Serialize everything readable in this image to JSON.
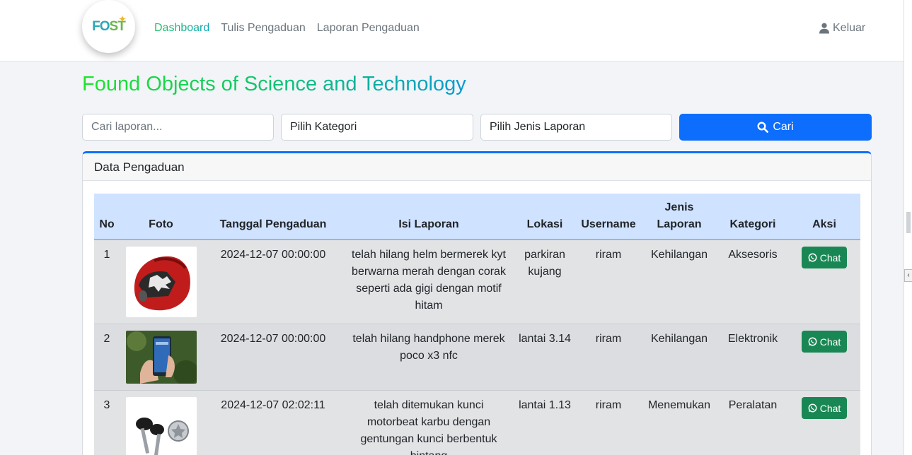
{
  "brand": {
    "logo_text_1": "FO",
    "logo_text_2": "ST",
    "logo_mark": "✦"
  },
  "nav": {
    "items": [
      {
        "label": "Dashboard",
        "active": true
      },
      {
        "label": "Tulis Pengaduan",
        "active": false
      },
      {
        "label": "Laporan Pengaduan",
        "active": false
      }
    ],
    "logout_label": "Keluar",
    "logout_icon": "user-icon"
  },
  "page": {
    "title": "Found Objects of Science and Technology"
  },
  "filters": {
    "search_placeholder": "Cari laporan...",
    "category_select": "Pilih Kategori",
    "type_select": "Pilih Jenis Laporan",
    "search_button": "Cari",
    "search_icon": "search-icon"
  },
  "card": {
    "header": "Data Pengaduan",
    "columns": [
      "No",
      "Foto",
      "Tanggal Pengaduan",
      "Isi Laporan",
      "Lokasi",
      "Username",
      "Jenis Laporan",
      "Kategori",
      "Aksi"
    ],
    "rows": [
      {
        "no": "1",
        "photo": "helmet-photo",
        "date": "2024-12-07 00:00:00",
        "content": "telah hilang helm bermerek kyt berwarna merah dengan corak seperti ada gigi dengan motif hitam",
        "location": "parkiran kujang",
        "username": "riram",
        "type": "Kehilangan",
        "category": "Aksesoris",
        "action": "Chat"
      },
      {
        "no": "2",
        "photo": "phone-photo",
        "date": "2024-12-07 00:00:00",
        "content": "telah hilang handphone merek poco x3 nfc",
        "location": "lantai 3.14",
        "username": "riram",
        "type": "Kehilangan",
        "category": "Elektronik",
        "action": "Chat"
      },
      {
        "no": "3",
        "photo": "keys-photo",
        "date": "2024-12-07 02:02:11",
        "content": "telah ditemukan kunci motorbeat karbu dengan gentungan kunci berbentuk bintang",
        "location": "lantai 1.13",
        "username": "riram",
        "type": "Menemukan",
        "category": "Peralatan",
        "action": "Chat"
      }
    ]
  },
  "colors": {
    "primary": "#0d6efd",
    "success": "#198754",
    "table_head": "#cfe2ff",
    "active_nav": "#19c37d"
  }
}
